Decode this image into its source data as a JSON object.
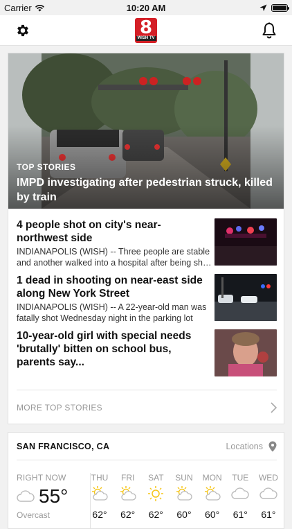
{
  "status_bar": {
    "carrier": "Carrier",
    "time": "10:20 AM"
  },
  "nav": {
    "logo_number": "8",
    "logo_text": "WISH TV"
  },
  "hero": {
    "kicker": "TOP STORIES",
    "title": "IMPD investigating after pedestrian struck, killed by train"
  },
  "stories": [
    {
      "title": "4 people shot on city's near-northwest side",
      "desc": "INDIANAPOLIS (WISH) -- Three people are stable and another walked into a hospital after being shot overnight",
      "thumb": "police-lights-night"
    },
    {
      "title": "1 dead in shooting on near-east side along New York Street",
      "desc": "INDIANAPOLIS (WISH) -- A 22-year-old man was fatally shot Wednesday night in the parking lot",
      "thumb": "police-cars-street-night"
    },
    {
      "title": "10-year-old girl with special needs 'brutally' bitten on school bus, parents say...",
      "desc": "",
      "thumb": "girl-portrait"
    }
  ],
  "more": {
    "label": "MORE TOP STORIES"
  },
  "weather": {
    "city": "SAN FRANCISCO, CA",
    "locations_label": "Locations",
    "now_label": "RIGHT NOW",
    "now_temp": "55°",
    "now_condition": "Overcast",
    "days": [
      {
        "name": "THU",
        "icon": "partly-sunny-icon",
        "temp": "62°"
      },
      {
        "name": "FRI",
        "icon": "partly-sunny-icon",
        "temp": "62°"
      },
      {
        "name": "SAT",
        "icon": "sunny-icon",
        "temp": "62°"
      },
      {
        "name": "SUN",
        "icon": "partly-sunny-icon",
        "temp": "60°"
      },
      {
        "name": "MON",
        "icon": "partly-sunny-icon",
        "temp": "60°"
      },
      {
        "name": "TUE",
        "icon": "cloudy-icon",
        "temp": "61°"
      },
      {
        "name": "WED",
        "icon": "cloudy-icon",
        "temp": "61°"
      }
    ]
  },
  "colors": {
    "brand": "#d41f26",
    "sun": "#f5c518",
    "muted": "#999999"
  }
}
